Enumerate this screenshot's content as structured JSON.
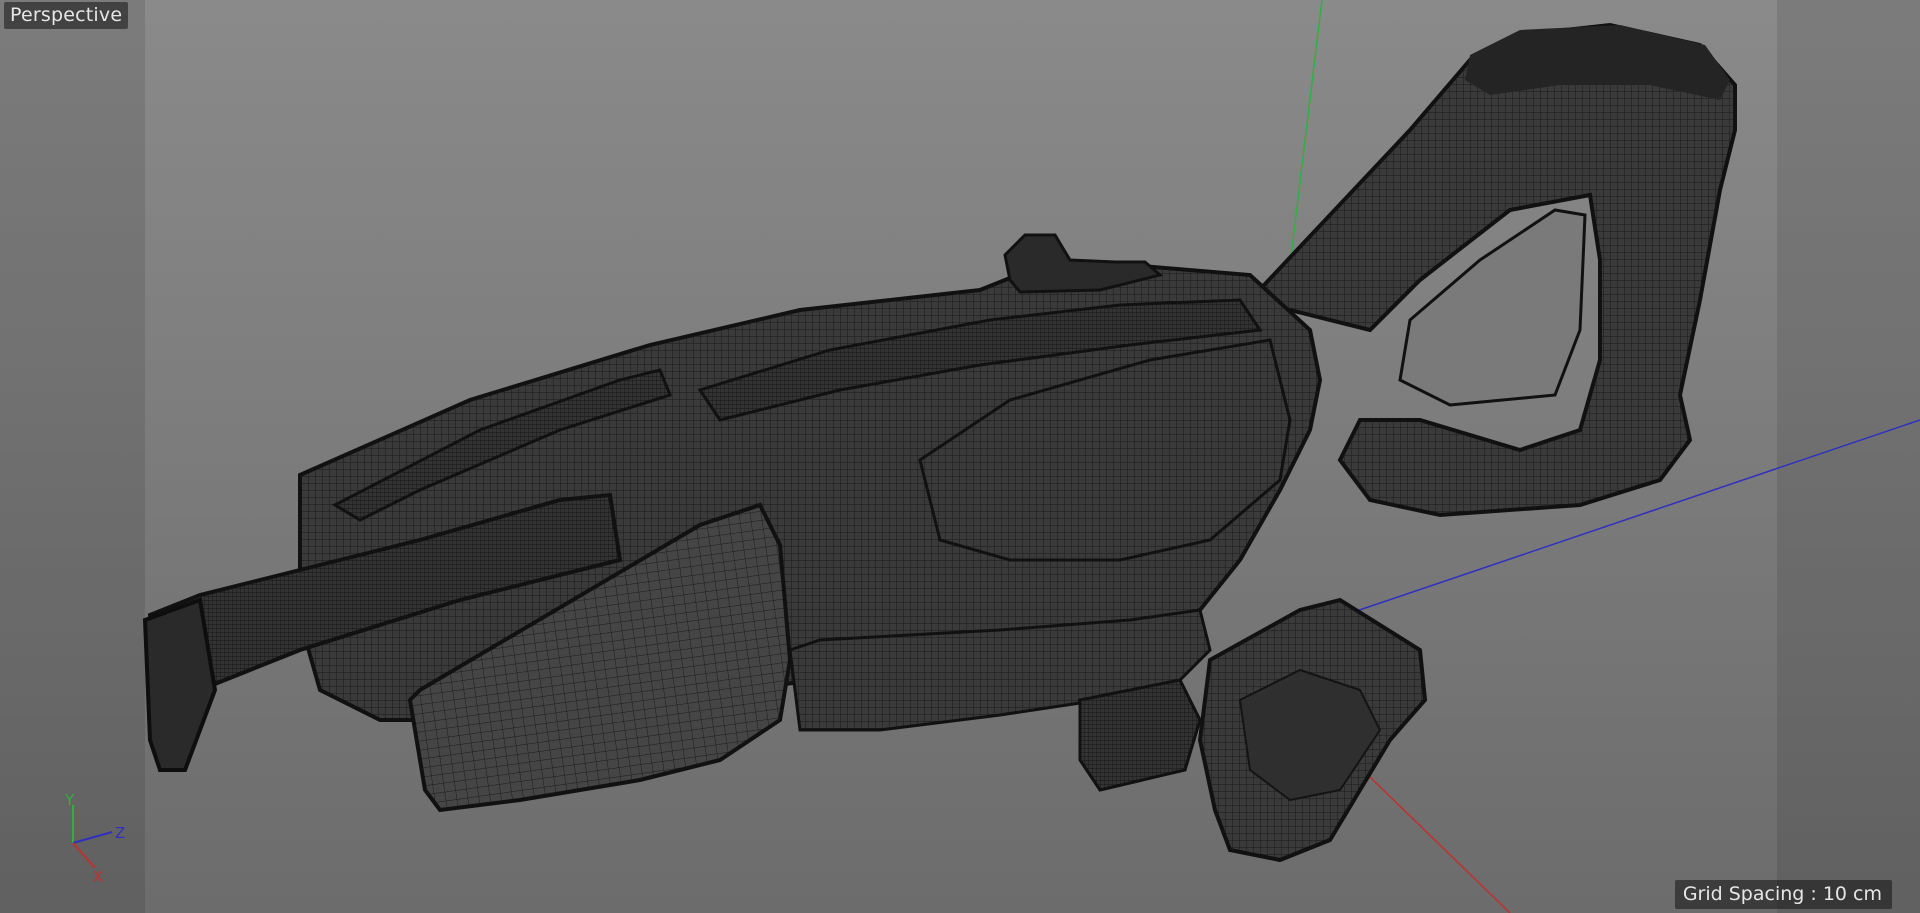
{
  "viewport": {
    "camera_label": "Perspective",
    "grid_spacing_label": "Grid Spacing : 10 cm"
  },
  "axis_gizmo": {
    "y_label": "Y",
    "z_label": "Z",
    "x_label": "X"
  },
  "colors": {
    "axis_x": "#c03030",
    "axis_y": "#30b040",
    "axis_z": "#3030c0",
    "mesh_fill": "#3a3a3a",
    "mesh_wire": "#1e1e1e",
    "background_top": "#8a8a8a",
    "background_bottom": "#6c6c6c"
  },
  "scene": {
    "object": "wireframe-rifle-mesh"
  }
}
